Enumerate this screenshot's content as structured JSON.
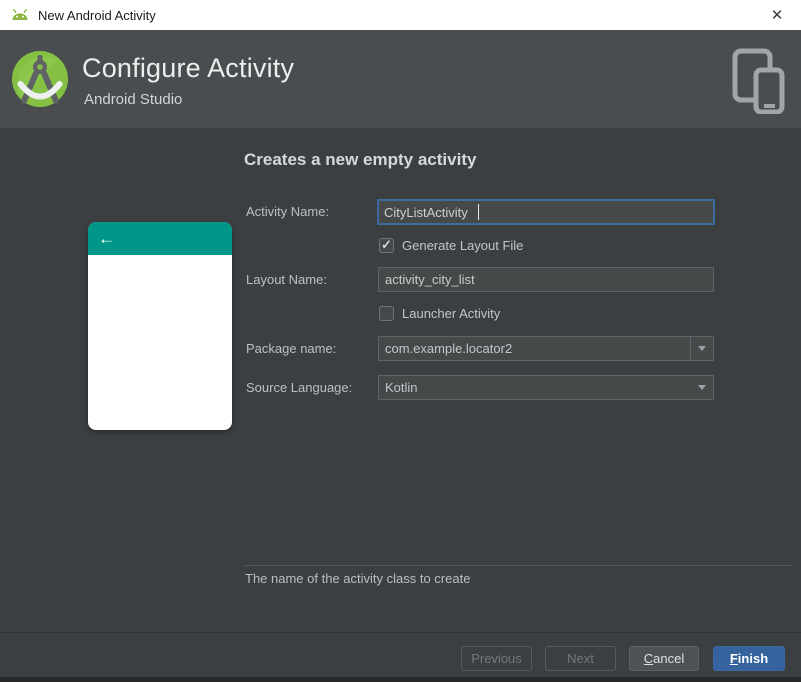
{
  "window": {
    "title": "New Android Activity",
    "close": "✕"
  },
  "header": {
    "title": "Configure Activity",
    "subtitle": "Android Studio"
  },
  "content": {
    "heading": "Creates a new empty activity",
    "preview": {
      "back_arrow": "←"
    },
    "fields": {
      "activity_name": {
        "label": "Activity Name:",
        "value": "CityListActivity"
      },
      "generate_layout_file": {
        "label": "Generate Layout File",
        "checked": true
      },
      "layout_name": {
        "label": "Layout Name:",
        "value": "activity_city_list"
      },
      "launcher_activity": {
        "label": "Launcher Activity",
        "checked": false
      },
      "package_name": {
        "label": "Package name:",
        "value": "com.example.locator2"
      },
      "source_language": {
        "label": "Source Language:",
        "value": "Kotlin"
      }
    },
    "hint": "The name of the activity class to create"
  },
  "footer": {
    "previous": "Previous",
    "next": "Next",
    "cancel_key": "C",
    "cancel_rest": "ancel",
    "finish_key": "F",
    "finish_rest": "inish"
  },
  "colors": {
    "accent_teal": "#009688",
    "focus_border": "#3e6b9e",
    "finish_button": "#35639d",
    "titlebar_bg": "#ffffff",
    "header_bg": "#4a4d4f",
    "content_bg": "#3c3f41"
  }
}
